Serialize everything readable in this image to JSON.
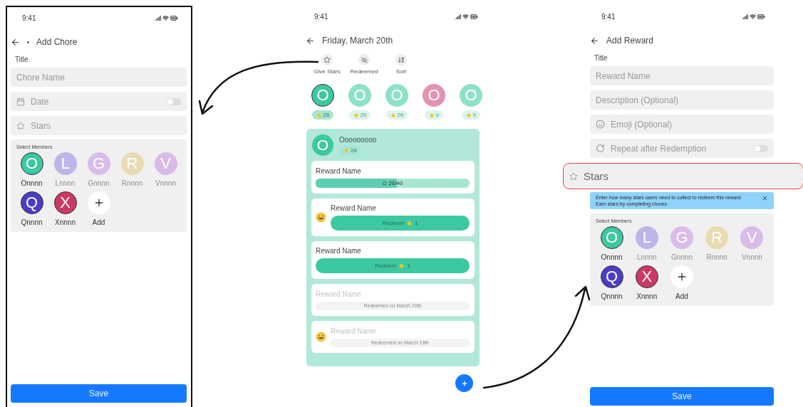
{
  "add_chore": {
    "status_bar": {
      "time": "9:41"
    },
    "header": {
      "title": "Add Chore"
    },
    "title_label": "Title",
    "fields": [
      {
        "kind": "text",
        "placeholder": "Chore Name"
      },
      {
        "kind": "date",
        "placeholder": "Date",
        "on": false
      },
      {
        "kind": "stars",
        "placeholder": "Stars",
        "highlighted": false
      }
    ],
    "members": {
      "label": "Select Members",
      "add_label": "Add",
      "items": [
        {
          "initial": "O",
          "name": "Onnnn",
          "color": "#3cc8a0",
          "selected": true
        },
        {
          "initial": "L",
          "name": "Lnnnn",
          "color": "#bdb6e8",
          "selected": false
        },
        {
          "initial": "G",
          "name": "Gnnnn",
          "color": "#d9bde9",
          "selected": false
        },
        {
          "initial": "R",
          "name": "Rnnnn",
          "color": "#e9dbb2",
          "selected": false
        },
        {
          "initial": "V",
          "name": "Vnnnn",
          "color": "#d8bbe8",
          "selected": false
        },
        {
          "initial": "Q",
          "name": "Qnnnn",
          "color": "#4b3cc8",
          "selected": true
        },
        {
          "initial": "X",
          "name": "Xnnnn",
          "color": "#cc3a64",
          "selected": true
        }
      ]
    },
    "save_button": "Save"
  },
  "day_view": {
    "status_bar": {
      "time": "9:41"
    },
    "header": {
      "title": "Friday, March 20th"
    },
    "toolbar": [
      {
        "kind": "star",
        "label": "Give Stars"
      },
      {
        "kind": "hidden",
        "label": "Redeemed"
      },
      {
        "kind": "sort",
        "label": "Sort"
      }
    ],
    "members": [
      {
        "initial": "O",
        "count": "26",
        "color": "#3cc8a0",
        "selected": true
      },
      {
        "initial": "O",
        "count": "26",
        "color": "#8fe0c8",
        "selected": false
      },
      {
        "initial": "O",
        "count": "26",
        "color": "#8fe0c8",
        "selected": false
      },
      {
        "initial": "O",
        "count": "0",
        "color": "#e392b2",
        "selected": false
      },
      {
        "initial": "O",
        "count": "0",
        "color": "#8fe0c8",
        "selected": false
      }
    ],
    "card": {
      "member": {
        "initial": "O",
        "name": "Ooooooooo",
        "count": "26"
      },
      "rewards": [
        {
          "kind": "progress",
          "name": "Reward Name",
          "emoji": false,
          "level": 0.53,
          "reading": "26/40"
        },
        {
          "kind": "redeem",
          "name": "Reward Name",
          "emoji": true,
          "button": "Redeem",
          "cost": "1"
        },
        {
          "kind": "redeem",
          "name": "Reward Name",
          "emoji": false,
          "button": "Redeem",
          "cost": "1"
        },
        {
          "kind": "redeemed",
          "name": "Reward Name",
          "emoji": false,
          "note": "Redeemed on March 20th"
        },
        {
          "kind": "redeemed",
          "name": "Reward Name",
          "emoji": true,
          "note": "Redeemed on March 19th"
        }
      ]
    }
  },
  "add_reward": {
    "status_bar": {
      "time": "9:41"
    },
    "header": {
      "title": "Add Reward"
    },
    "title_label": "Title",
    "fields": [
      {
        "kind": "text",
        "placeholder": "Reward Name"
      },
      {
        "kind": "text",
        "placeholder": "Description (Optional)"
      },
      {
        "kind": "emoji",
        "placeholder": "Emoji (Optional)"
      },
      {
        "kind": "repeat",
        "placeholder": "Repeat after Redemption",
        "on": false
      },
      {
        "kind": "stars",
        "placeholder": "Stars",
        "highlighted": true
      }
    ],
    "info": {
      "lines": [
        "Enter how many stars users need to collect to redeem this reward",
        "Earn stars by completing chores."
      ]
    },
    "members": {
      "label": "Select Members",
      "add_label": "Add",
      "items": [
        {
          "initial": "O",
          "name": "Onnnn",
          "color": "#3cc8a0",
          "selected": true
        },
        {
          "initial": "L",
          "name": "Lnnnn",
          "color": "#bdb6e8",
          "selected": false
        },
        {
          "initial": "G",
          "name": "Gnnnn",
          "color": "#d9bde9",
          "selected": false
        },
        {
          "initial": "R",
          "name": "Rnnnn",
          "color": "#e9dbb2",
          "selected": false
        },
        {
          "initial": "V",
          "name": "Vnnnn",
          "color": "#d8bbe8",
          "selected": false
        },
        {
          "initial": "Q",
          "name": "Qnnnn",
          "color": "#4b3cc8",
          "selected": true
        },
        {
          "initial": "X",
          "name": "Xnnnn",
          "color": "#cc3a64",
          "selected": true
        }
      ]
    },
    "save_button": "Save"
  }
}
